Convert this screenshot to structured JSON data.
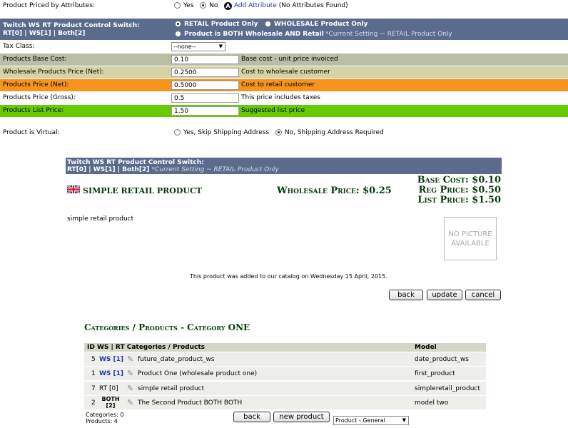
{
  "attributes": {
    "label": "Product Priced by Attributes:",
    "opt_yes": "Yes",
    "opt_no": "No",
    "add_link": "Add Attribute",
    "status": "(No Attributes Found)"
  },
  "switch_top": {
    "title": "Twitch WS RT Product Control Switch:",
    "codes": "RT[0] | WS[1] | Both[2]",
    "opt_retail": "RETAIL Product Only",
    "opt_wholesale": "WHOLESALE Product Only",
    "opt_both": "Product is BOTH Wholesale AND Retail",
    "current": "*Current Setting ~ RETAIL Product Only"
  },
  "tax": {
    "label": "Tax Class:",
    "value": "--none--"
  },
  "fields": {
    "base_cost": {
      "label": "Products Base Cost:",
      "value": "0.10",
      "hint": "Base cost - unit price invoiced"
    },
    "wholesale": {
      "label": "Wholesale Products Price (Net):",
      "value": "0.2500",
      "hint": "Cost to wholesale customer"
    },
    "net": {
      "label": "Products Price (Net):",
      "value": "0.5000",
      "hint": "Cost to retail customer"
    },
    "gross": {
      "label": "Products Price (Gross):",
      "value": "0.5",
      "hint": "This price includes taxes"
    },
    "list": {
      "label": "Products List Price:",
      "value": "1.50",
      "hint": "Suggested list price"
    }
  },
  "virtual": {
    "label": "Product is Virtual:",
    "opt_yes": "Yes, Skip Shipping Address",
    "opt_no": "No, Shipping Address Required"
  },
  "preview": {
    "switch_title": "Twitch WS RT Product Control Switch:",
    "switch_codes": "RT[0] | WS[1] | Both[2]",
    "switch_current": "*Current Setting ~ RETAIL Product Only",
    "product_name": "simple retail product",
    "wholesale_price": "Wholesale Price: $0.25",
    "base_cost": "Base Cost: $0.10",
    "reg_price": "Reg Price: $0.50",
    "list_price": "List Price: $1.50",
    "description": "simple retail product",
    "no_picture_1": "NO PICTURE",
    "no_picture_2": "AVAILABLE",
    "added_note": "This product was added to our catalog on Wednesday 15 April, 2015.",
    "btn_back": "back",
    "btn_update": "update",
    "btn_cancel": "cancel"
  },
  "catalog": {
    "title": "Categories / Products - Category ONE",
    "col_id": "ID WS | RT Categories / Products",
    "col_model": "Model",
    "rows": [
      {
        "id": "5",
        "type": "WS [1]",
        "name": "future_date_product_ws",
        "model": "date_product_ws"
      },
      {
        "id": "1",
        "type": "WS [1]",
        "name": "Product One (wholesale product one)",
        "model": "first_product"
      },
      {
        "id": "7",
        "type": "RT [0]",
        "name": "simple retail product",
        "model": "simpleretail_product"
      },
      {
        "id": "2",
        "type": "BOTH [2]",
        "name": "The Second Product BOTH BOTH",
        "model": "model two"
      }
    ],
    "categories_count": "Categories: 0",
    "products_count": "Products: 4",
    "btn_back": "back",
    "btn_new": "new product",
    "select_value": "Product - General"
  }
}
